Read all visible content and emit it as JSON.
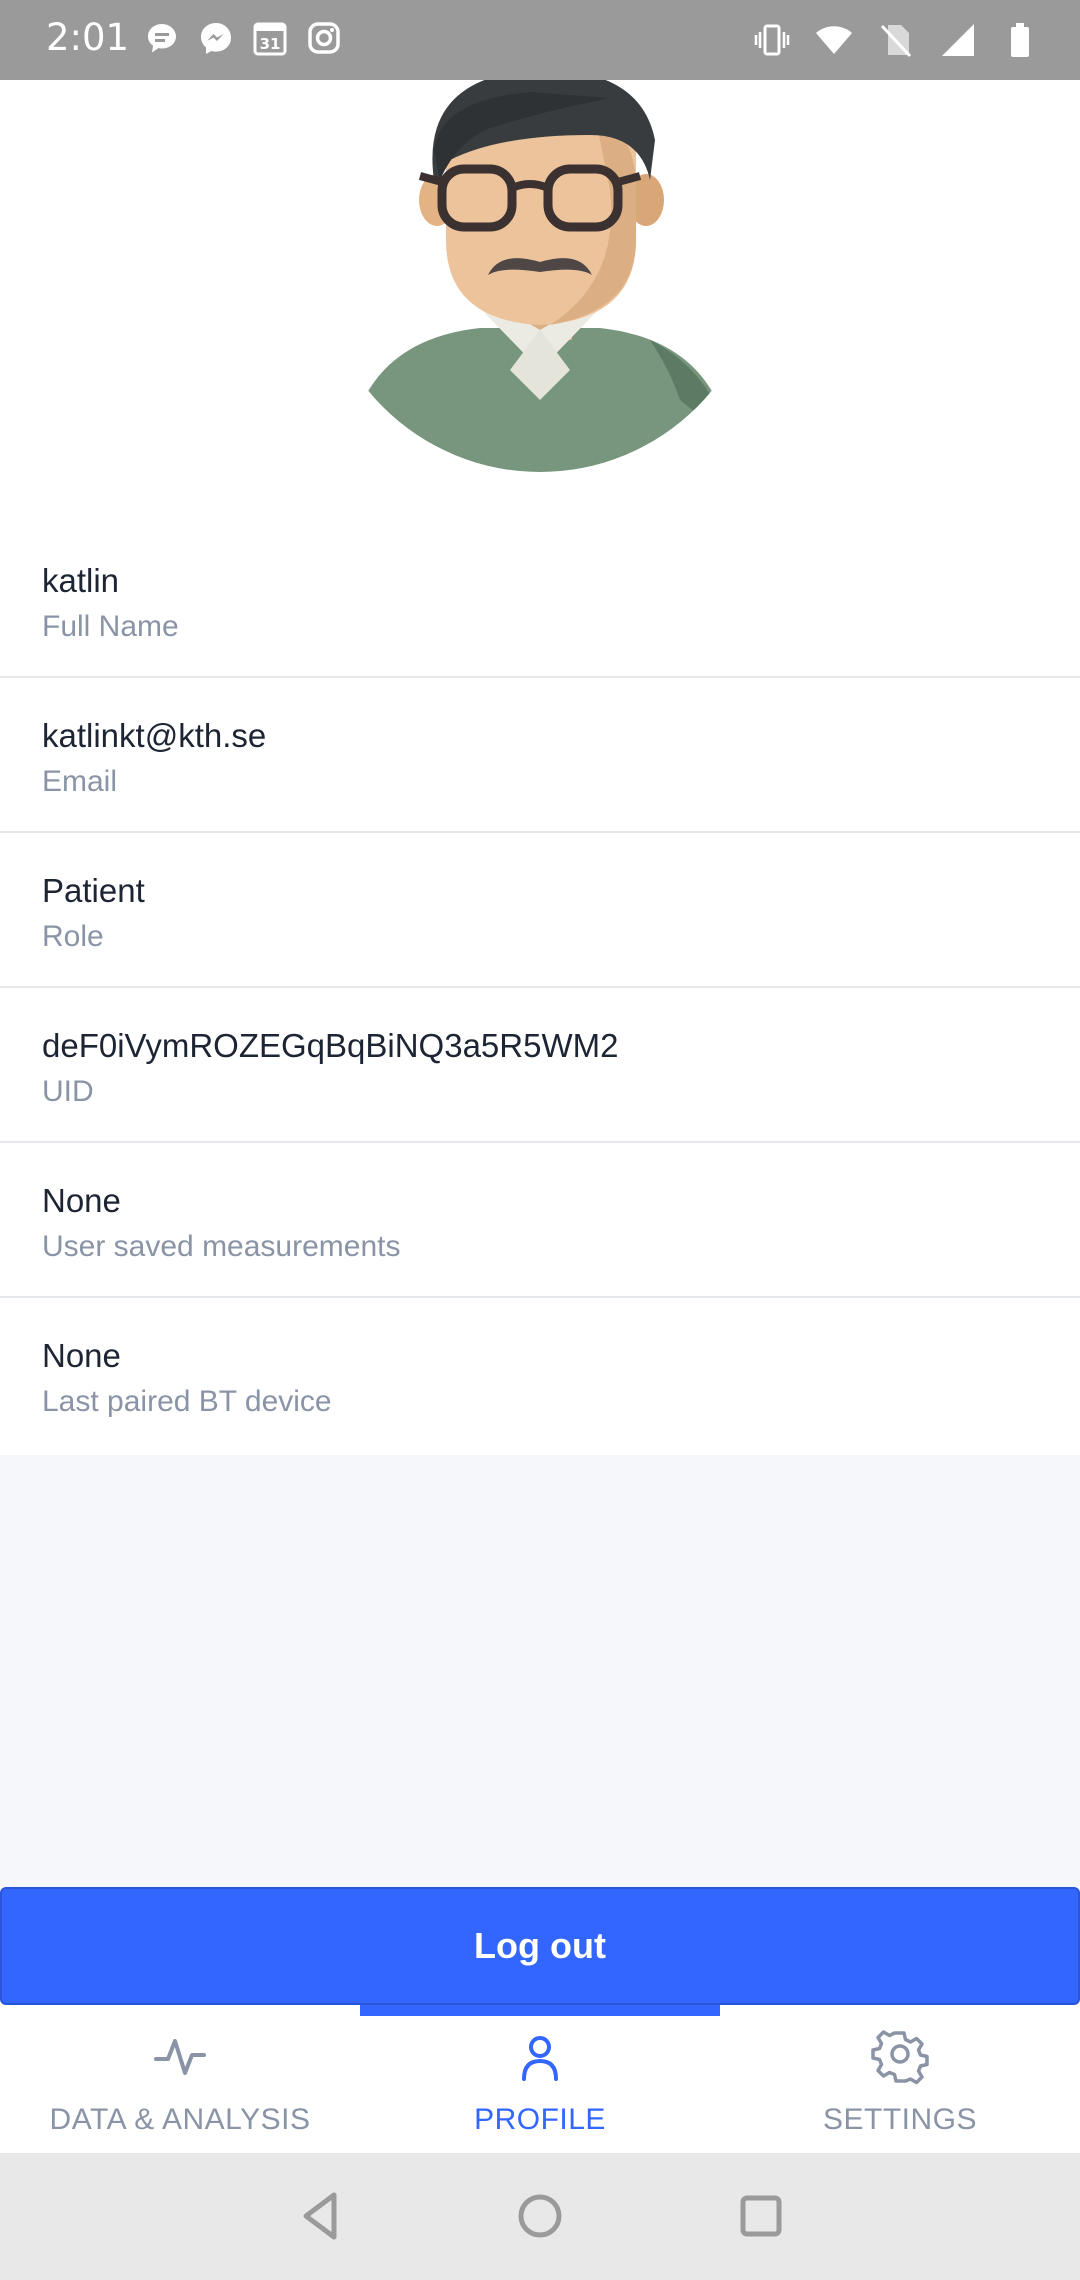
{
  "status_bar": {
    "time": "2:01",
    "left_icons": [
      "chat-bubble-icon",
      "messenger-icon",
      "calendar-icon",
      "instagram-icon"
    ],
    "calendar_day": "31",
    "right_icons": [
      "vibrate-icon",
      "wifi-icon",
      "no-sim-icon",
      "signal-icon",
      "battery-icon"
    ]
  },
  "profile": {
    "avatar": "avatar-illustration",
    "rows": [
      {
        "value": "katlin",
        "label": "Full Name"
      },
      {
        "value": "katlinkt@kth.se",
        "label": "Email"
      },
      {
        "value": "Patient",
        "label": "Role"
      },
      {
        "value": "deF0iVymROZEGqBqBiNQ3a5R5WM2",
        "label": "UID"
      },
      {
        "value": "None",
        "label": "User saved measurements"
      },
      {
        "value": "None",
        "label": "Last paired BT device"
      }
    ]
  },
  "logout_label": "Log out",
  "bottom_nav": {
    "tabs": [
      {
        "label": "DATA & ANALYSIS",
        "icon": "activity-icon"
      },
      {
        "label": "PROFILE",
        "icon": "user-icon"
      },
      {
        "label": "SETTINGS",
        "icon": "gear-icon"
      }
    ],
    "active_tab": "PROFILE"
  },
  "colors": {
    "accent": "#3366ff",
    "status_bar": "#9a9a9a",
    "primary_text": "#1d2433",
    "secondary_text": "#8a94a6",
    "background_grey": "#f6f7fb"
  }
}
